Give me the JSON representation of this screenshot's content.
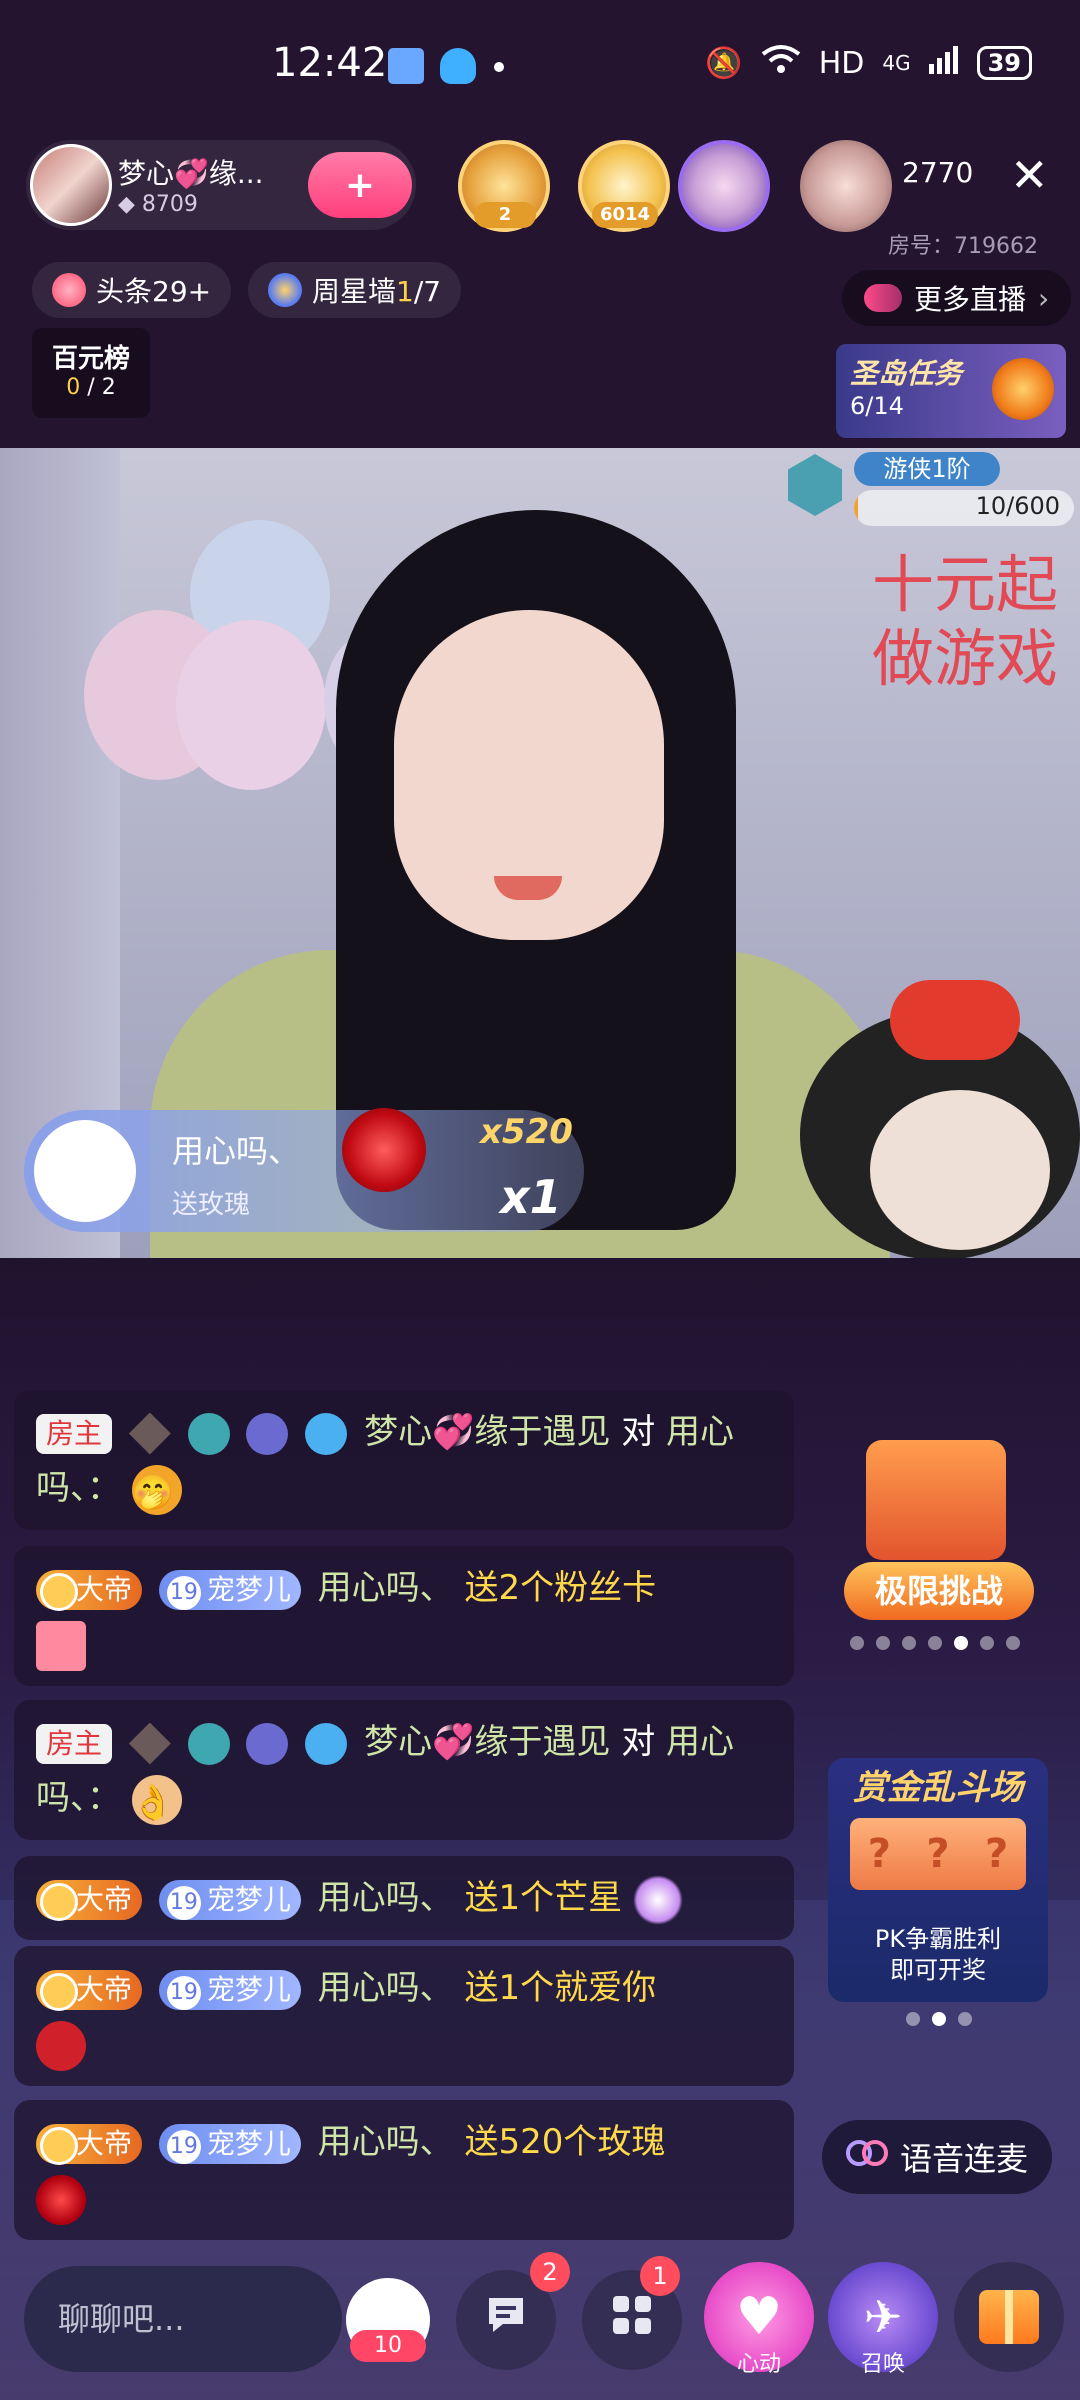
{
  "status_bar": {
    "time": "12:42",
    "network": "HD",
    "signal": "4G",
    "battery": "39"
  },
  "host": {
    "name": "梦心💞缘...",
    "fans": "8709",
    "follow_icon": "heart-plus-icon"
  },
  "viewers": {
    "badge_1": "2",
    "badge_2": "6014",
    "count": "2770",
    "room_label": "房号：719662"
  },
  "chips": {
    "headline": "头条29+",
    "weekly_star_prefix": "周星墙",
    "weekly_star_value": "1",
    "weekly_star_total": "/7",
    "more_live": "更多直播"
  },
  "rank": {
    "title": "百元榜",
    "current": "0",
    "total": " / 2"
  },
  "task": {
    "title": "圣岛任务",
    "progress": "6/14"
  },
  "level": {
    "label": "游侠1阶",
    "progress_text": "10/600",
    "progress_fraction": 0.0167
  },
  "promo_text": {
    "line1": "十元起",
    "line2": "做游戏"
  },
  "gift_banner": {
    "user": "用心吗、",
    "action": "送玫瑰",
    "multiplier": "x520",
    "count": "x1"
  },
  "messages": [
    {
      "tag": "房主",
      "name": "梦心💞缘于遇见",
      "connector": " 对 ",
      "target": "用心吗、：",
      "emoji": "🤭"
    },
    {
      "tag": "大帝",
      "level": "19",
      "fan": "宠梦儿",
      "user": "用心吗、",
      "gift": "送2个粉丝卡"
    },
    {
      "tag": "房主",
      "name": "梦心💞缘于遇见",
      "connector": " 对 ",
      "target": "用心吗、：",
      "emoji": "👌"
    },
    {
      "tag": "大帝",
      "level": "19",
      "fan": "宠梦儿",
      "user": "用心吗、",
      "gift": "送1个芒星"
    },
    {
      "tag": "大帝",
      "level": "19",
      "fan": "宠梦儿",
      "user": "用心吗、",
      "gift": "送1个就爱你"
    },
    {
      "tag": "大帝",
      "level": "19",
      "fan": "宠梦儿",
      "user": "用心吗、",
      "gift": "送520个玫瑰"
    }
  ],
  "challenge": {
    "label": "极限挑战"
  },
  "bounty": {
    "title": "赏金乱斗场",
    "slot": "?",
    "desc_line1": "PK争霸胜利",
    "desc_line2": "即可开奖"
  },
  "voice": {
    "label": "语音连麦"
  },
  "bottom_bar": {
    "input_placeholder": "聊聊吧...",
    "pk_count": "10",
    "message_badge": "2",
    "apps_badge": "1",
    "heart_label": "心动",
    "summon_label": "召唤"
  },
  "colors": {
    "gift_text": "#ffd94a",
    "nickname": "#cfe6a8",
    "owner_tag": "#e0363c",
    "progress": "#f3a12d"
  }
}
